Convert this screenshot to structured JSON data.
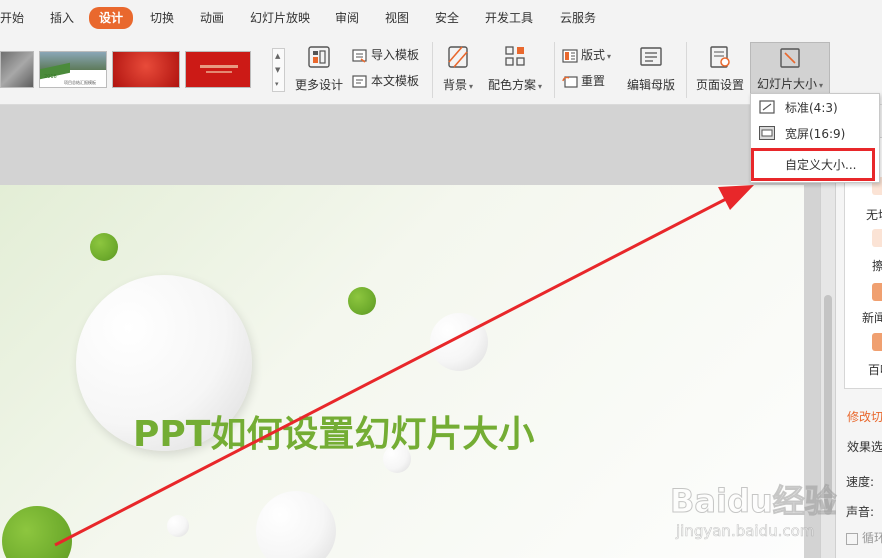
{
  "menu": {
    "tabs": [
      "开始",
      "插入",
      "设计",
      "切换",
      "动画",
      "幻灯片放映",
      "审阅",
      "视图",
      "安全",
      "开发工具",
      "云服务"
    ],
    "active": "设计"
  },
  "ribbon": {
    "thumb_texts": [
      "2016",
      "项目总结汇报模板"
    ],
    "more_design": "更多设计",
    "import_template": "导入模板",
    "this_template": "本文模板",
    "background": "背景",
    "color_scheme": "配色方案",
    "layout": "版式",
    "reset": "重置",
    "edit_master": "编辑母版",
    "page_setup": "页面设置",
    "slide_size": "幻灯片大小"
  },
  "dropdown": {
    "standard": "标准(4:3)",
    "widescreen": "宽屏(16:9)",
    "custom": "自定义大小..."
  },
  "slide": {
    "title": "PPT如何设置幻灯片大小"
  },
  "right_pane": {
    "items": [
      "无切",
      "擦",
      "新闻",
      "百叶"
    ],
    "modify": "修改切",
    "effect": "效果选",
    "speed": "速度:",
    "sound": "声音:",
    "loop": "循环"
  },
  "watermark": {
    "brand": "Baidu经验",
    "url": "jingyan.baidu.com"
  },
  "colors": {
    "accent": "#e9682d",
    "highlight": "#e8272a",
    "title_green": "#74ad34",
    "arrow": "#e8272a"
  }
}
